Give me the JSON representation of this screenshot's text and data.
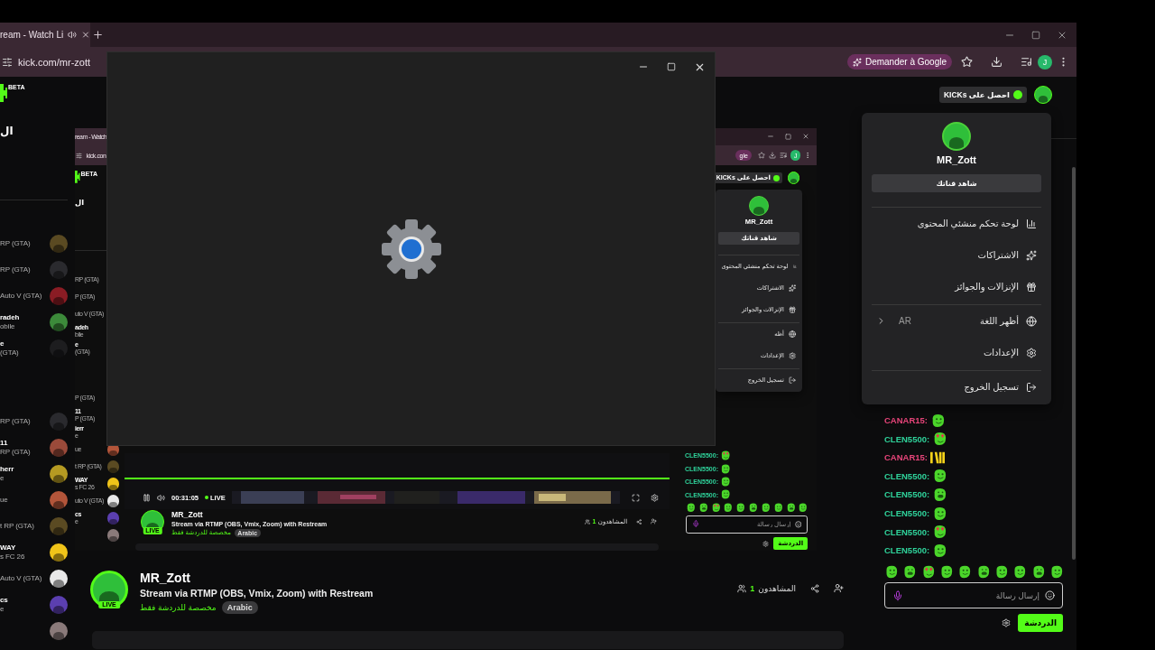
{
  "browser": {
    "tab_title": "ream - Watch Li",
    "url": "kick.com/mr-zott",
    "ask_google": "Demander à Google",
    "profile_initial": "J"
  },
  "sidebar": {
    "logo_badge": "BETA",
    "heading": "ال",
    "groups": [
      [
        {
          "lines": [
            "RP (GTA)"
          ],
          "avatar": true
        },
        {
          "lines": [
            "RP (GTA)"
          ],
          "avatar": true
        },
        {
          "lines": [
            "Auto V (GTA)"
          ],
          "avatar": true
        },
        {
          "lines": [
            "radeh",
            "obile"
          ],
          "avatar": true
        },
        {
          "lines": [
            "e",
            "(GTA)"
          ],
          "avatar": true
        }
      ],
      [
        {
          "lines": [
            "RP (GTA)"
          ],
          "avatar": true
        },
        {
          "lines": [
            "11",
            "RP (GTA)"
          ],
          "avatar": true
        },
        {
          "lines": [
            "herr",
            "e"
          ],
          "avatar": true
        },
        {
          "lines": [
            "ue"
          ],
          "avatar": true
        },
        {
          "lines": [
            "t RP (GTA)"
          ],
          "avatar": true
        },
        {
          "lines": [
            "WAY",
            "s FC 26"
          ],
          "avatar": true
        },
        {
          "lines": [
            "Auto V (GTA)"
          ],
          "avatar": true
        },
        {
          "lines": [
            "cs",
            "e"
          ],
          "avatar": true
        },
        {
          "avatar": true
        }
      ]
    ]
  },
  "header": {
    "kicks_button": "احصل على KICKs"
  },
  "user_menu": {
    "username": "MR_Zott",
    "channel_button": "شاهد قناتك",
    "groups": [
      [
        {
          "kind": "dashboard",
          "label": "لوحة تحكم منشئي المحتوى"
        },
        {
          "kind": "subscriptions",
          "label": "الاشتراكات"
        },
        {
          "kind": "drops",
          "label": "الإنزالات والجوائز"
        }
      ],
      [
        {
          "kind": "language",
          "label": "أظهر اللغة",
          "value": "AR"
        },
        {
          "kind": "settings",
          "label": "الإعدادات"
        }
      ],
      [
        {
          "kind": "logout",
          "label": "تسجيل الخروج"
        }
      ]
    ]
  },
  "video": {
    "tab_title": "ream - Watch",
    "url": "kick.con",
    "ask_google": "gle",
    "profile_initial": "J",
    "logo_badge": "BETA",
    "heading": "ال",
    "sidebar_groups": [
      [
        {
          "lines": [
            "RP (GTA)"
          ],
          "avatar": false
        },
        {
          "lines": [
            "P (GTA)"
          ],
          "avatar": false
        },
        {
          "lines": [
            "uto V (GTA)"
          ],
          "avatar": false
        },
        {
          "lines": [
            "adeh",
            "bile"
          ],
          "avatar": false
        },
        {
          "lines": [
            "e",
            "(GTA)"
          ],
          "avatar": false
        }
      ],
      [
        {
          "lines": [
            "P (GTA)"
          ],
          "avatar": false
        },
        {
          "lines": [
            "11",
            "P (GTA)"
          ],
          "avatar": false
        },
        {
          "lines": [
            "ierr",
            "e"
          ],
          "avatar": false
        },
        {
          "lines": [
            "ue"
          ],
          "avatar": true
        },
        {
          "lines": [
            "t RP (GTA)"
          ],
          "avatar": true
        },
        {
          "lines": [
            "WAY",
            "s FC 26"
          ],
          "avatar": true
        },
        {
          "lines": [
            "uto V (GTA)"
          ],
          "avatar": true
        },
        {
          "lines": [
            "cs",
            "e"
          ],
          "avatar": true
        },
        {
          "avatar": true
        }
      ]
    ],
    "kicks_button": "احصل على KICKs",
    "menu": {
      "username": "MR_Zott",
      "channel_button": "شاهد قناتك",
      "groups": [
        [
          {
            "kind": "dashboard",
            "label": "لوحة تحكم منشئي المحتوى"
          },
          {
            "kind": "subscriptions",
            "label": "الاشتراكات"
          },
          {
            "kind": "drops",
            "label": "الإنزالات والجوائز"
          }
        ],
        [
          {
            "kind": "language",
            "label": "أظه"
          },
          {
            "kind": "settings",
            "label": "الإعدادات"
          }
        ],
        [
          {
            "kind": "logout",
            "label": "تسجيل الخروج"
          }
        ]
      ]
    },
    "player": {
      "level": 1,
      "time": "00:31:05",
      "live": "LIVE"
    },
    "info": {
      "live_badge": "LIVE",
      "name": "MR_Zott",
      "title": "Stream via RTMP (OBS, Vmix, Zoom) with Restream",
      "note": "مخصصة للدردشة فقط",
      "tag": "Arabic",
      "viewers_count": "1",
      "viewers_label": "المشاهدون"
    },
    "chat": {
      "messages": [
        {
          "user": "CLEN5500:",
          "color": "#2fd39b",
          "kind": "love"
        },
        {
          "user": "CLEN5500:",
          "color": "#2fd39b",
          "kind": "smile"
        },
        {
          "user": "CLEN5500:",
          "color": "#2fd39b",
          "kind": "smile"
        },
        {
          "user": "CLEN5500:",
          "color": "#2fd39b",
          "kind": "smile"
        }
      ],
      "placeholder": "إرسال رسالة",
      "send_button": "الدردشة"
    }
  },
  "stream_info": {
    "live_badge": "LIVE",
    "name": "MR_Zott",
    "title": "Stream via RTMP (OBS, Vmix, Zoom) with Restream",
    "note": "مخصصة للدردشة فقط",
    "tag": "Arabic",
    "viewers_count": "1",
    "viewers_label": "المشاهدون"
  },
  "chat": {
    "messages": [
      {
        "user": "CANAR15:",
        "color": "#e8457a",
        "kind": "smile"
      },
      {
        "user": "CLEN5500:",
        "color": "#2fd39b",
        "kind": "love"
      },
      {
        "user": "CANAR15:",
        "color": "#e8457a",
        "kind": "banner"
      },
      {
        "user": "CLEN5500:",
        "color": "#2fd39b",
        "kind": "smile"
      },
      {
        "user": "CLEN5500:",
        "color": "#2fd39b",
        "kind": "grin"
      },
      {
        "user": "CLEN5500:",
        "color": "#2fd39b",
        "kind": "smile"
      },
      {
        "user": "CLEN5500:",
        "color": "#2fd39b",
        "kind": "love"
      },
      {
        "user": "CLEN5500:",
        "color": "#2fd39b",
        "kind": "smile"
      }
    ],
    "placeholder": "إرسال رسالة",
    "send_button": "الدردشة"
  }
}
